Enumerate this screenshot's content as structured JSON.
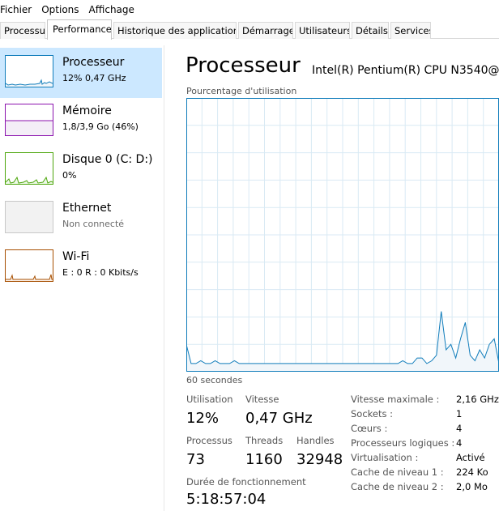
{
  "menu": [
    "Fichier",
    "Options",
    "Affichage"
  ],
  "tabs": [
    "Processus",
    "Performance",
    "Historique des applications",
    "Démarrage",
    "Utilisateurs",
    "Détails",
    "Services"
  ],
  "active_tab": "Performance",
  "sidebar": {
    "items": [
      {
        "title": "Processeur",
        "subtitle": "12% 0,47 GHz",
        "color": "#117dbb",
        "selected": true
      },
      {
        "title": "Mémoire",
        "subtitle": "1,8/3,9 Go (46%)",
        "color": "#8b12ae",
        "selected": false
      },
      {
        "title": "Disque 0 (C: D:)",
        "subtitle": "0%",
        "color": "#4da60c",
        "selected": false
      },
      {
        "title": "Ethernet",
        "subtitle": "Non connecté",
        "color": "#c8c8c8",
        "selected": false
      },
      {
        "title": "Wi-Fi",
        "subtitle": "E : 0 R : 0 Kbits/s",
        "color": "#a74f01",
        "selected": false
      }
    ]
  },
  "main": {
    "title": "Processeur",
    "cpu_name": "Intel(R) Pentium(R) CPU N3540@",
    "graph_label": "Pourcentage d'utilisation",
    "graph_time_label": "60 secondes",
    "stats": {
      "utilisation_label": "Utilisation",
      "utilisation": "12%",
      "vitesse_label": "Vitesse",
      "vitesse": "0,47 GHz",
      "processus_label": "Processus",
      "processus": "73",
      "threads_label": "Threads",
      "threads": "1160",
      "handles_label": "Handles",
      "handles": "32948",
      "uptime_label": "Durée de fonctionnement",
      "uptime": "5:18:57:04"
    },
    "specs": [
      {
        "label": "Vitesse maximale :",
        "value": "2,16 GHz"
      },
      {
        "label": "Sockets :",
        "value": "1"
      },
      {
        "label": "Cœurs :",
        "value": "4"
      },
      {
        "label": "Processeurs logiques :",
        "value": "4"
      },
      {
        "label": "Virtualisation :",
        "value": "Activé"
      },
      {
        "label": "Cache de niveau 1 :",
        "value": "224 Ko"
      },
      {
        "label": "Cache de niveau 2 :",
        "value": "2,0 Mo"
      }
    ]
  },
  "cpu_graph": {
    "max": 100,
    "series": [
      10,
      3,
      3,
      4,
      3,
      3,
      4,
      3,
      3,
      3,
      4,
      3,
      3,
      3,
      3,
      3,
      3,
      3,
      3,
      3,
      3,
      3,
      3,
      3,
      3,
      3,
      3,
      3,
      3,
      3,
      3,
      3,
      3,
      3,
      3,
      3,
      3,
      3,
      3,
      3,
      3,
      3,
      3,
      3,
      3,
      4,
      3,
      3,
      5,
      5,
      3,
      4,
      6,
      22,
      8,
      10,
      5,
      12,
      18,
      6,
      4,
      8,
      5,
      10,
      12,
      3
    ]
  },
  "colors": {
    "cpu_line": "#117dbb",
    "cpu_fill": "#f1f6fa",
    "grid": "#d9eaf4",
    "selected": "#cce8ff"
  }
}
